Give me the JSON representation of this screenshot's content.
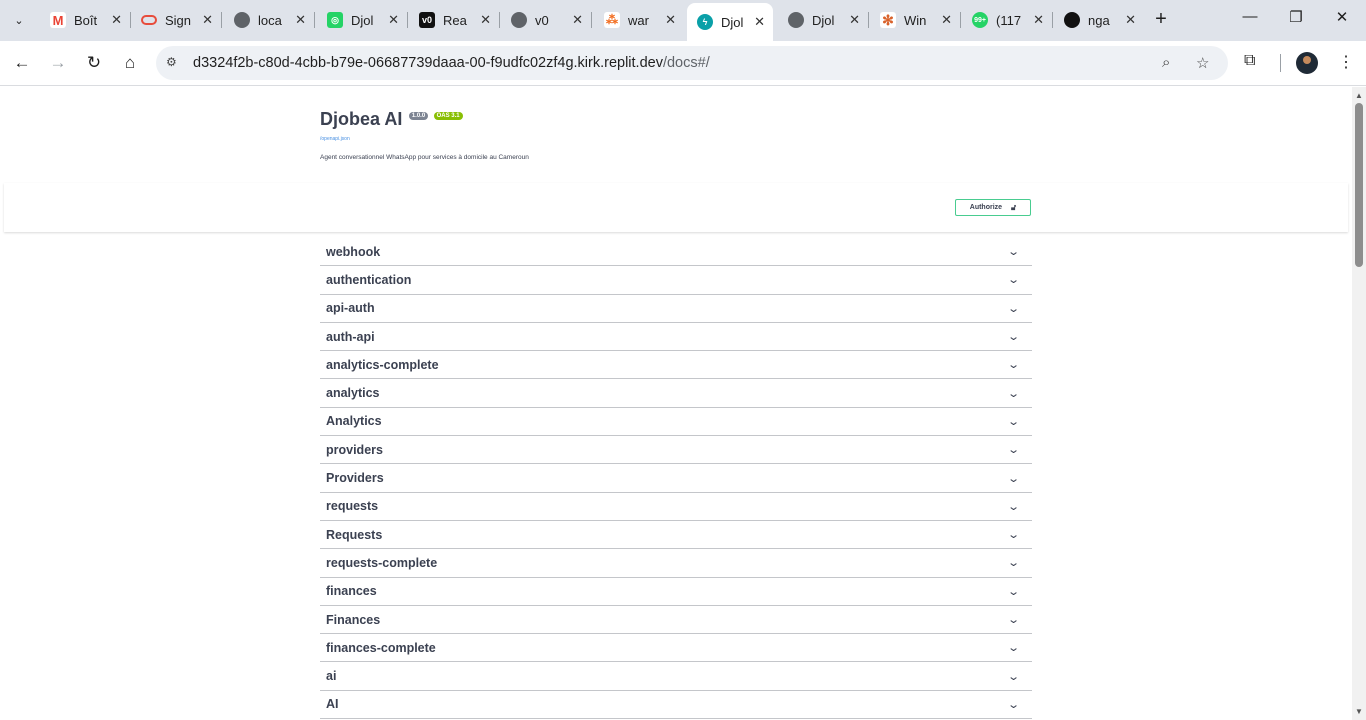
{
  "browser": {
    "tabs": [
      {
        "title": "Boît",
        "favicon": "gmail-icon",
        "color": "#ea4335"
      },
      {
        "title": "Sign",
        "favicon": "oracle-icon",
        "color": "#e74c3c"
      },
      {
        "title": "loca",
        "favicon": "globe-icon",
        "color": "#5f6368"
      },
      {
        "title": "Djol",
        "favicon": "whatsapp-icon",
        "color": "#25d366"
      },
      {
        "title": "Rea",
        "favicon": "vercel-icon",
        "color": "#111111"
      },
      {
        "title": "v0",
        "favicon": "globe-icon",
        "color": "#5f6368"
      },
      {
        "title": "war",
        "favicon": "stack-icon",
        "color": "#f26b1d"
      },
      {
        "title": "Djol",
        "favicon": "flash-icon",
        "color": "#0aa0a8"
      },
      {
        "title": "Djol",
        "favicon": "globe-icon",
        "color": "#5f6368"
      },
      {
        "title": "Win",
        "favicon": "sparkle-icon",
        "color": "#d9622b"
      },
      {
        "title": "(117",
        "favicon": "whatsapp-badge-icon",
        "color": "#25d366"
      },
      {
        "title": "nga",
        "favicon": "github-icon",
        "color": "#111111"
      }
    ],
    "url_host": "d3324f2b-c80d-4cbb-b79e-06687739daaa-00-f9udfc02zf4g.kirk.replit.dev",
    "url_path": "/docs#/"
  },
  "page": {
    "title": "Djobea AI",
    "version": "1.0.0",
    "oas": "OAS 3.1",
    "spec_link": "/openapi.json",
    "description": "Agent conversationnel WhatsApp pour services à domicile au Cameroun",
    "authorize_label": "Authorize",
    "tags": [
      "webhook",
      "authentication",
      "api-auth",
      "auth-api",
      "analytics-complete",
      "analytics",
      "Analytics",
      "providers",
      "Providers",
      "requests",
      "Requests",
      "requests-complete",
      "finances",
      "Finances",
      "finances-complete",
      "ai",
      "AI"
    ]
  }
}
